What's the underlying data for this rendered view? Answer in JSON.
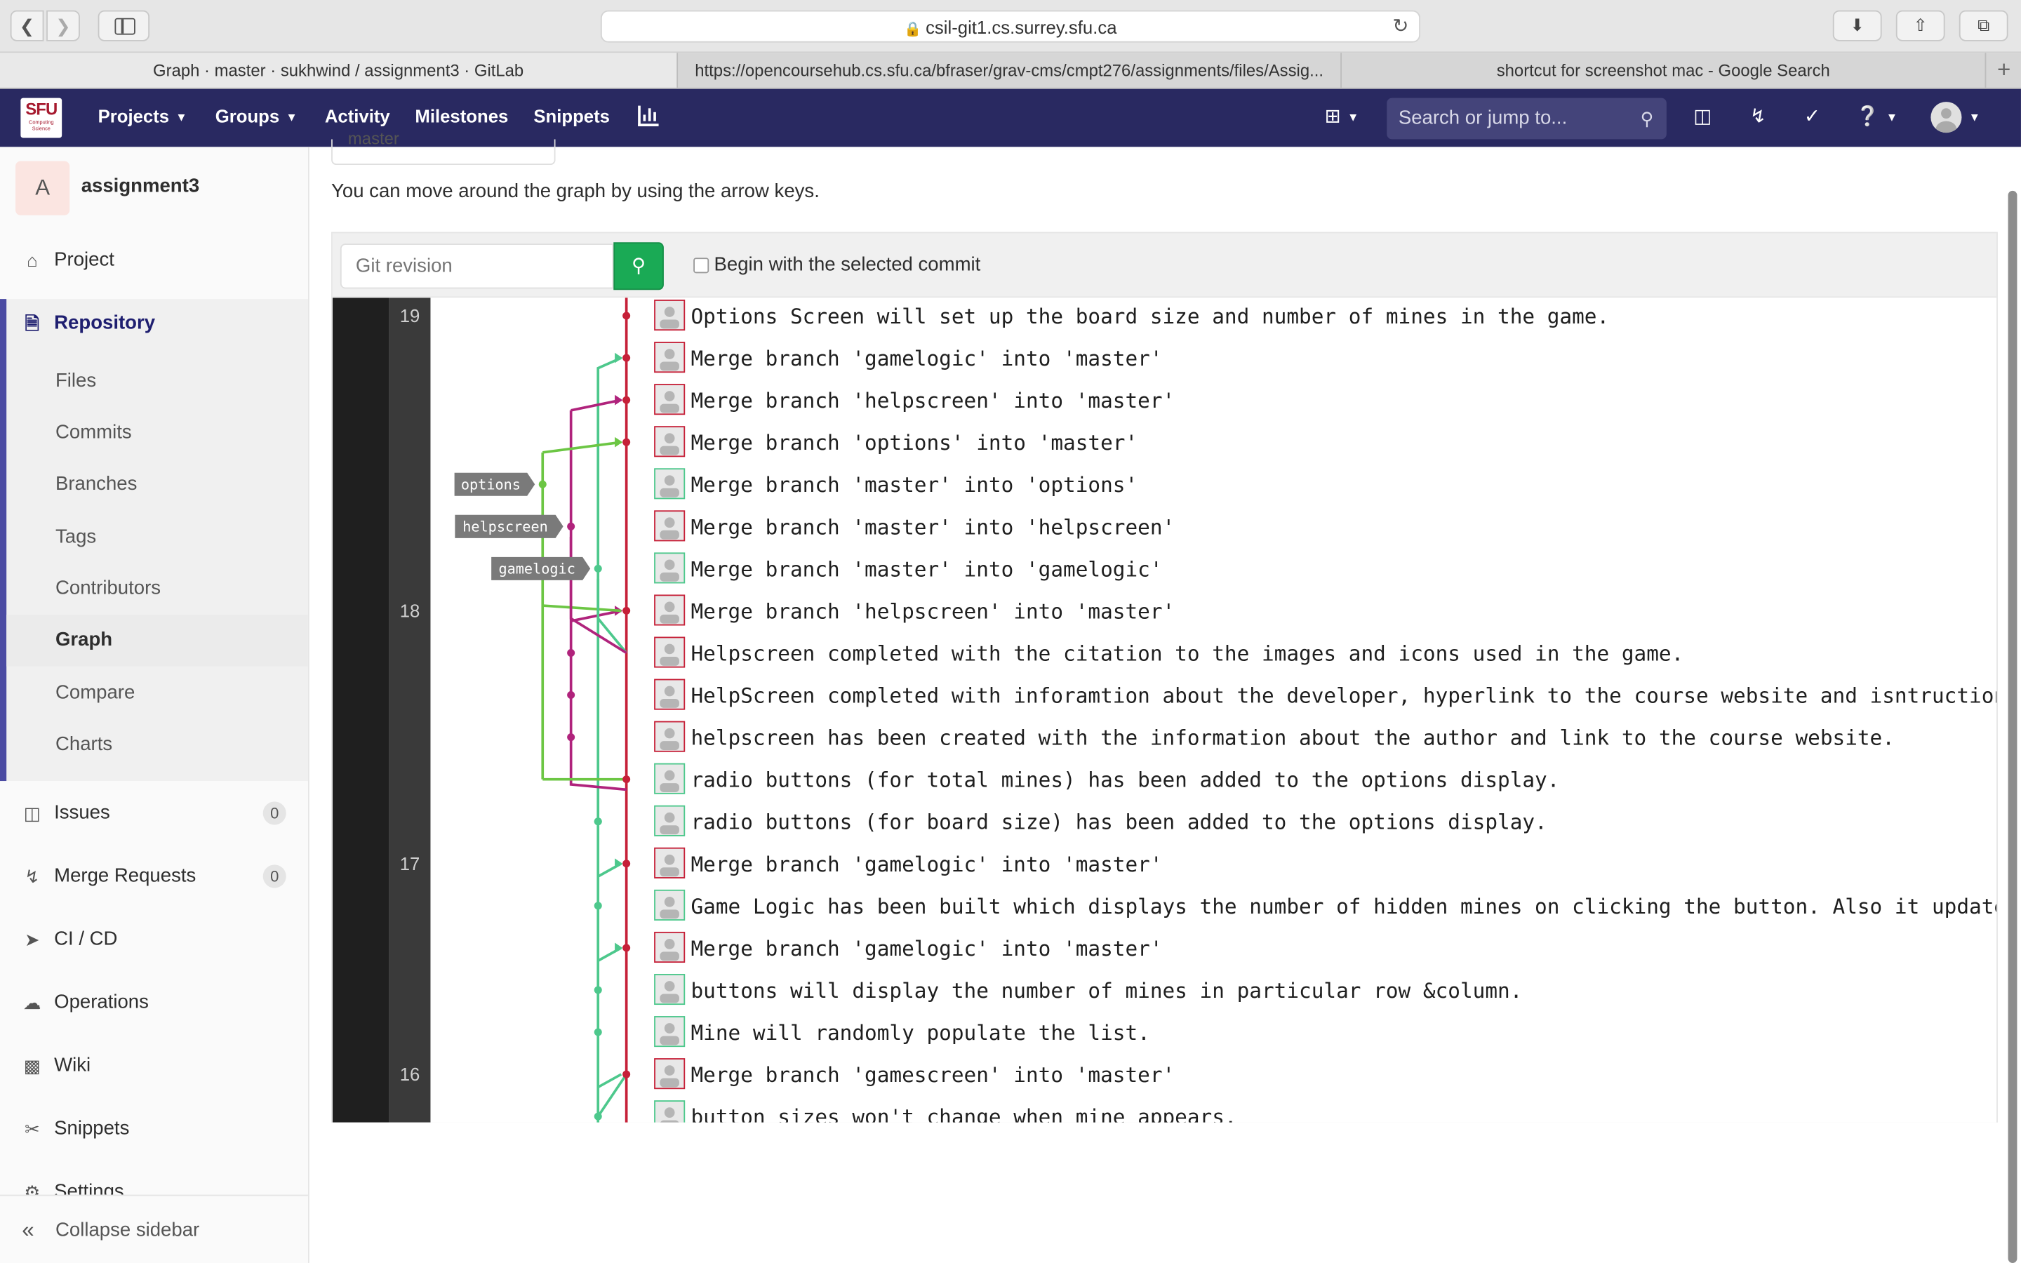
{
  "browser": {
    "url": "csil-git1.cs.surrey.sfu.ca",
    "tabs": [
      {
        "title": "Graph · master · sukhwind / assignment3 · GitLab"
      },
      {
        "title": "https://opencoursehub.cs.sfu.ca/bfraser/grav-cms/cmpt276/assignments/files/Assig..."
      },
      {
        "title": "shortcut for screenshot mac - Google Search"
      }
    ]
  },
  "header": {
    "logo_text": "SFU",
    "logo_sub": "Computing Science",
    "nav": [
      "Projects",
      "Groups",
      "Activity",
      "Milestones",
      "Snippets"
    ],
    "search_placeholder": "Search or jump to..."
  },
  "sidebar": {
    "project_initial": "A",
    "project_name": "assignment3",
    "items": {
      "project": "Project",
      "repository": "Repository",
      "issues": "Issues",
      "merge_requests": "Merge Requests",
      "cicd": "CI / CD",
      "operations": "Operations",
      "wiki": "Wiki",
      "snippets": "Snippets",
      "settings": "Settings"
    },
    "repo_sub": [
      "Files",
      "Commits",
      "Branches",
      "Tags",
      "Contributors",
      "Graph",
      "Compare",
      "Charts"
    ],
    "issues_count": "0",
    "mr_count": "0",
    "collapse": "Collapse sidebar"
  },
  "main": {
    "branch_select": "master",
    "hint": "You can move around the graph by using the arrow keys.",
    "revision_placeholder": "Git revision",
    "begin_label": "Begin with the selected commit"
  },
  "graph": {
    "day_labels": [
      {
        "text": "19",
        "row": 0
      },
      {
        "text": "18",
        "row": 7
      },
      {
        "text": "17",
        "row": 13
      },
      {
        "text": "16",
        "row": 18
      }
    ],
    "branch_labels": [
      {
        "text": "options",
        "row": 4
      },
      {
        "text": "helpscreen",
        "row": 5
      },
      {
        "text": "gamelogic",
        "row": 6
      }
    ],
    "commits": [
      {
        "message": "Options Screen will set up the board size and number of mines in the game.",
        "author": "red"
      },
      {
        "message": "Merge branch 'gamelogic' into 'master'",
        "author": "red"
      },
      {
        "message": "Merge branch 'helpscreen' into 'master'",
        "author": "red"
      },
      {
        "message": "Merge branch 'options' into 'master'",
        "author": "red"
      },
      {
        "message": "Merge branch 'master' into 'options'",
        "author": "green"
      },
      {
        "message": "Merge branch 'master' into 'helpscreen'",
        "author": "red"
      },
      {
        "message": "Merge branch 'master' into 'gamelogic'",
        "author": "green"
      },
      {
        "message": "Merge branch 'helpscreen' into 'master'",
        "author": "red"
      },
      {
        "message": "Helpscreen completed with the citation to the images and icons used in the game.",
        "author": "red"
      },
      {
        "message": "HelpScreen completed with inforamtion about the developer, hyperlink to the course website and isntruction about the game.",
        "author": "red"
      },
      {
        "message": "helpscreen has been created with the information about the author and link to the course website.",
        "author": "red"
      },
      {
        "message": "radio buttons (for total mines) has been added to the options display.",
        "author": "green"
      },
      {
        "message": "radio buttons (for board size) has been added to the options display.",
        "author": "green"
      },
      {
        "message": "Merge branch 'gamelogic' into 'master'",
        "author": "red"
      },
      {
        "message": "Game Logic has been built which displays the number of hidden mines on clicking the button. Also it update the number of mines left.",
        "author": "green"
      },
      {
        "message": "Merge branch 'gamelogic' into 'master'",
        "author": "red"
      },
      {
        "message": "buttons will display the number of mines in particular row &column.",
        "author": "green"
      },
      {
        "message": "Mine will randomly populate the list.",
        "author": "green"
      },
      {
        "message": "Merge branch 'gamescreen' into 'master'",
        "author": "red"
      },
      {
        "message": "button sizes won't change when mine appears.",
        "author": "green"
      }
    ],
    "colors": {
      "master": "#c62038",
      "helpscreen": "#b0237c",
      "gamelogic": "#4dc88c",
      "options": "#6cc644",
      "label_bg": "#7a7a7a"
    }
  }
}
